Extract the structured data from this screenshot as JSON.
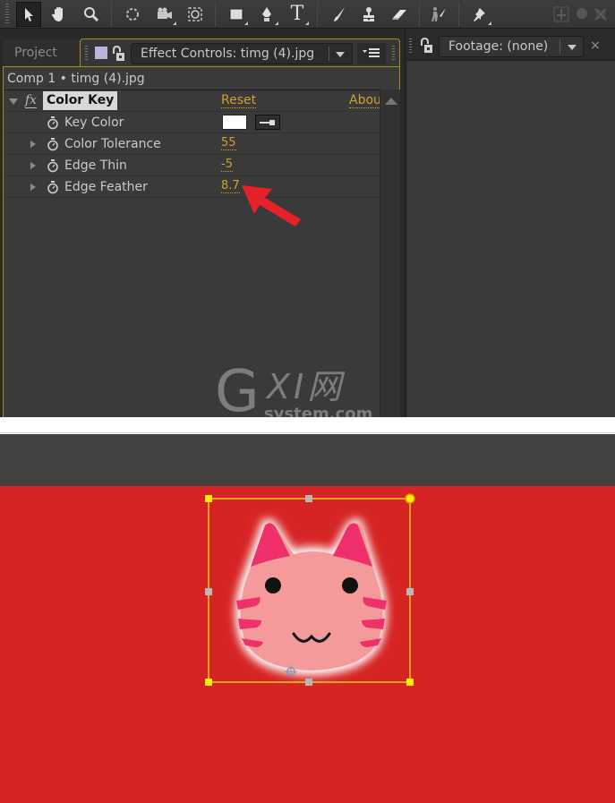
{
  "toolbar": {
    "tools": [
      {
        "name": "selection-tool",
        "icon": "arrow-pointer-icon",
        "active": true
      },
      {
        "name": "hand-tool",
        "icon": "hand-icon"
      },
      {
        "name": "zoom-tool",
        "icon": "magnifier-icon"
      },
      {
        "name": "rotation-tool",
        "icon": "rotate-icon"
      },
      {
        "name": "camera-tool",
        "icon": "camera-icon"
      },
      {
        "name": "pan-behind-tool",
        "icon": "pan-behind-icon"
      },
      {
        "name": "rectangle-tool",
        "icon": "rectangle-icon"
      },
      {
        "name": "pen-tool",
        "icon": "pen-icon"
      },
      {
        "name": "type-tool",
        "icon": "type-icon",
        "glyph": "T"
      },
      {
        "name": "brush-tool",
        "icon": "brush-icon"
      },
      {
        "name": "clone-stamp-tool",
        "icon": "stamp-icon"
      },
      {
        "name": "eraser-tool",
        "icon": "eraser-icon"
      },
      {
        "name": "roto-brush-tool",
        "icon": "roto-brush-icon"
      },
      {
        "name": "puppet-pin-tool",
        "icon": "pin-icon"
      }
    ]
  },
  "left_panel": {
    "tabs": [
      {
        "label": "Project",
        "active": false
      },
      {
        "label": "Effect Controls: timg (4).jpg",
        "active": true
      }
    ],
    "comp_label": "Comp 1 • timg (4).jpg",
    "effect": {
      "name": "Color Key",
      "fx_badge": "fx",
      "reset_label": "Reset",
      "about_label": "About...",
      "properties": [
        {
          "label": "Key Color",
          "type": "color",
          "value": "#ffffff"
        },
        {
          "label": "Color Tolerance",
          "type": "number",
          "value": "55"
        },
        {
          "label": "Edge Thin",
          "type": "number",
          "value": "-5"
        },
        {
          "label": "Edge Feather",
          "type": "number",
          "value": "8.7"
        }
      ]
    }
  },
  "right_panel": {
    "tab_label": "Footage: (none)",
    "close_label": "×"
  },
  "watermark": {
    "g": "G",
    "xi": "XI网",
    "url": "system.com"
  },
  "colors": {
    "accent": "#d4a02a",
    "panel_border": "#a88a2a",
    "canvas_bg": "#d62424",
    "annotation_arrow": "#e8202a",
    "selection": "#f0c020"
  }
}
